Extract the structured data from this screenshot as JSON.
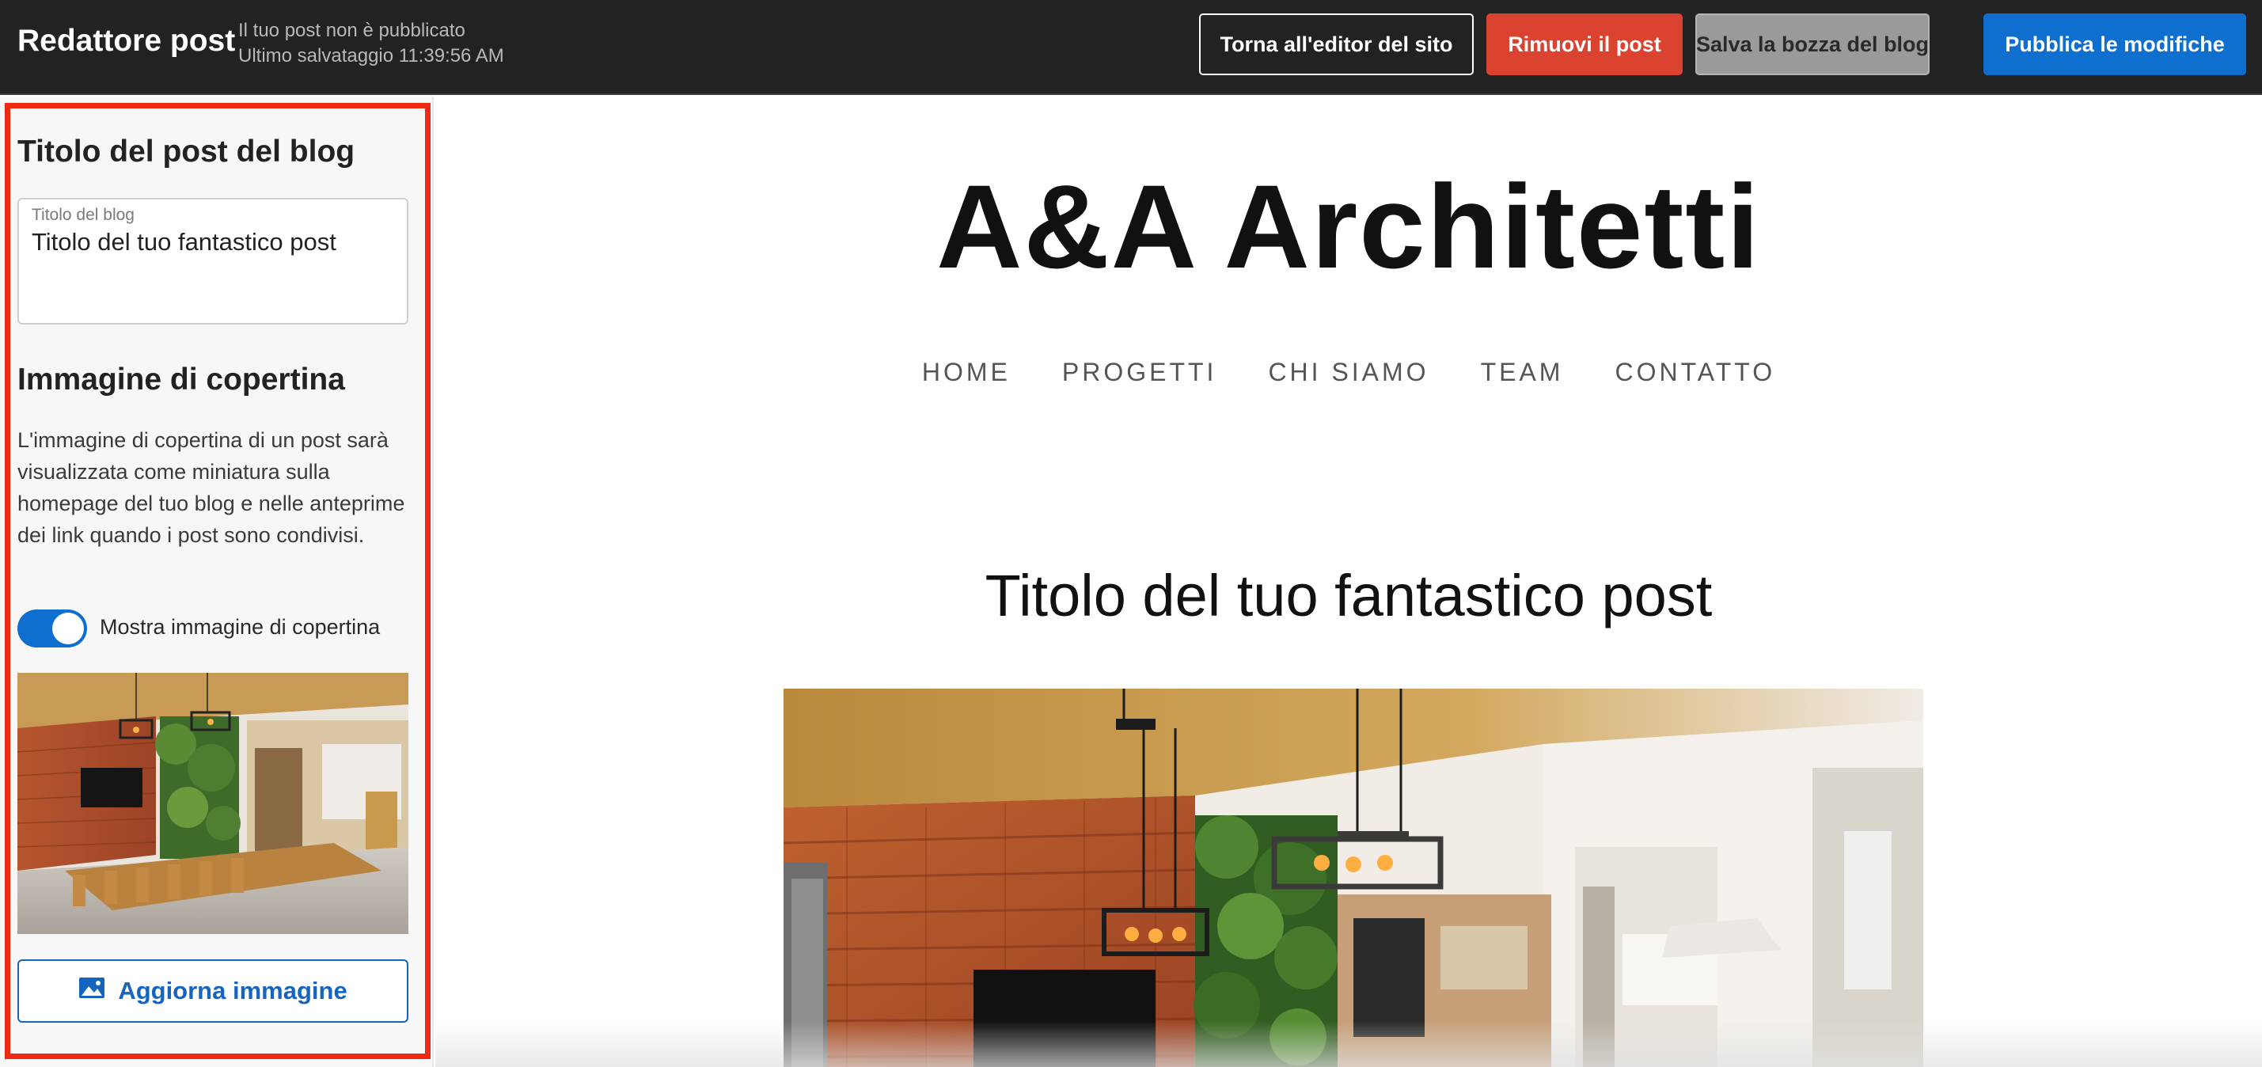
{
  "topbar": {
    "title": "Redattore post",
    "status_line1": "Il tuo post non è pubblicato",
    "status_line2": "Ultimo salvataggio 11:39:56 AM",
    "btn_back": "Torna all'editor del sito",
    "btn_remove": "Rimuovi il post",
    "btn_draft": "Salva la bozza del blog",
    "btn_publish": "Pubblica le modifiche"
  },
  "sidebar": {
    "post_title_heading": "Titolo del post del blog",
    "title_field_label": "Titolo del blog",
    "title_field_value": "Titolo del tuo fantastico post",
    "cover_heading": "Immagine di copertina",
    "cover_description": "L'immagine di copertina di un post sarà visualizzata come miniatura sulla homepage del tuo blog e nelle anteprime dei link quando i post sono condivisi.",
    "toggle_label": "Mostra immagine di copertina",
    "toggle_on": true,
    "update_image_label": "Aggiorna immagine"
  },
  "preview": {
    "site_name": "A&A Architetti",
    "nav": [
      "HOME",
      "PROGETTI",
      "CHI SIAMO",
      "TEAM",
      "CONTATTO"
    ],
    "post_title": "Titolo del tuo fantastico post"
  },
  "colors": {
    "topbar_bg": "#222222",
    "remove": "#d9432f",
    "draft": "#9a9a9a",
    "publish": "#0e6fcf",
    "highlight": "#ee2a15",
    "accent": "#1565c0"
  },
  "icons": {
    "update_image": "image-icon"
  }
}
